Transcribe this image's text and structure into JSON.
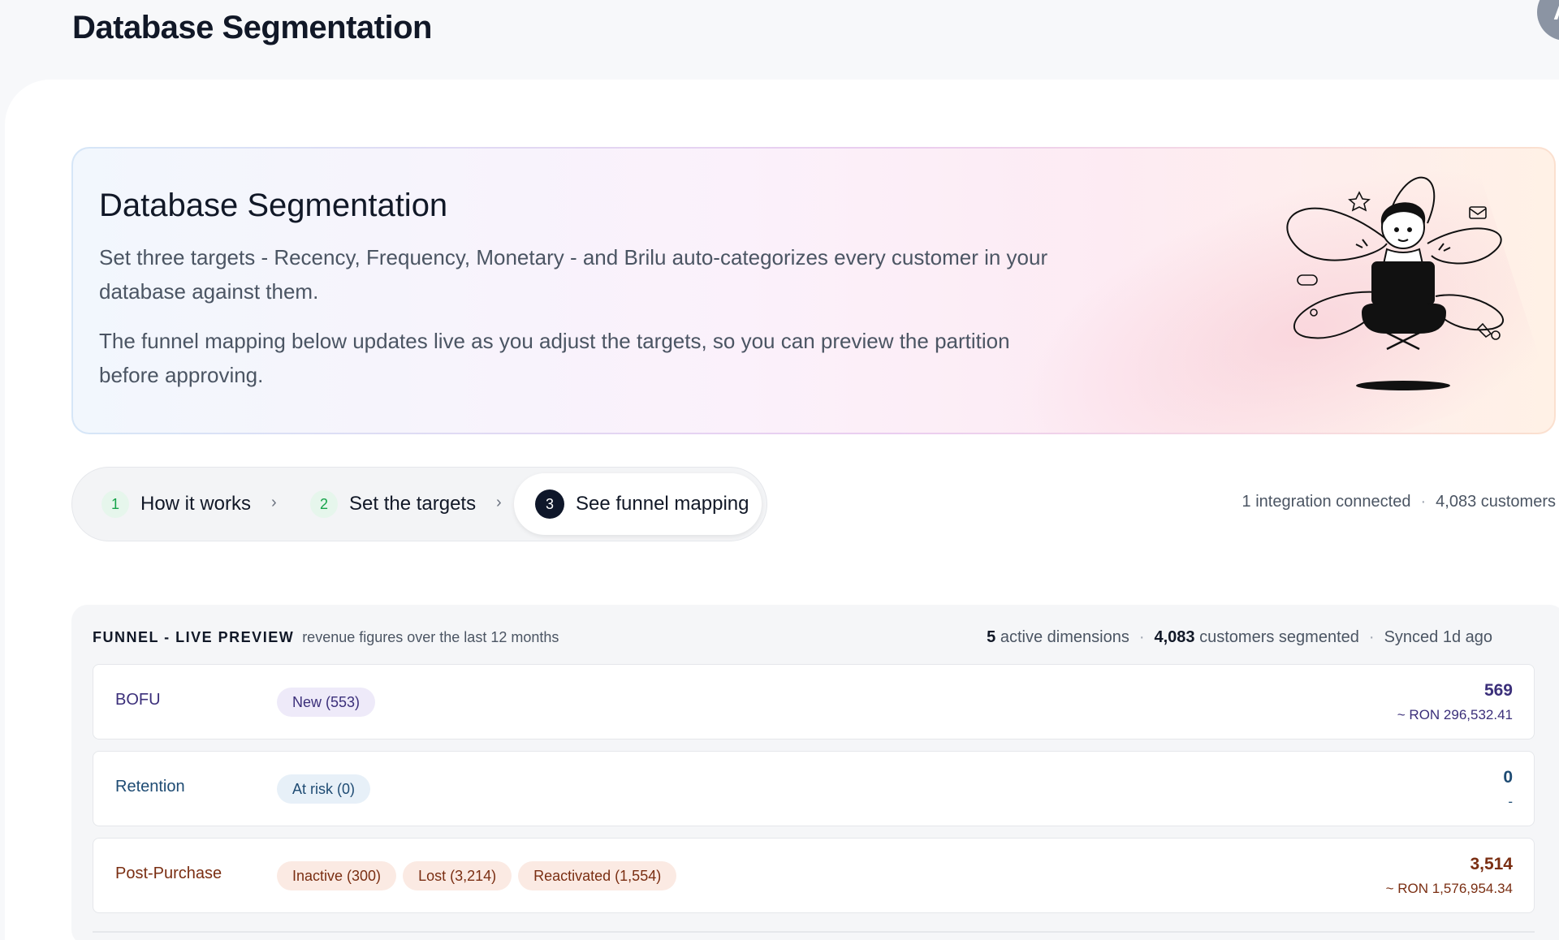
{
  "header": {
    "title": "Database Segmentation",
    "avatar_initial": "A"
  },
  "hero": {
    "title": "Database Segmentation",
    "paragraph1": "Set three targets - Recency, Frequency, Monetary - and Brilu auto-categorizes every customer in your database against them.",
    "paragraph2": "The funnel mapping below updates live as you adjust the targets, so you can preview the partition before approving.",
    "illustration_icon": "person-with-laptop-icon"
  },
  "stepper": {
    "steps": [
      {
        "number": "1",
        "label": "How it works"
      },
      {
        "number": "2",
        "label": "Set the targets"
      },
      {
        "number": "3",
        "label": "See funnel mapping"
      }
    ],
    "separator": "›",
    "active_index": 2
  },
  "integration": {
    "connected": "1 integration connected",
    "separator": "·",
    "customers": "4,083 customers"
  },
  "funnel": {
    "title": "FUNNEL - LIVE PREVIEW",
    "subtitle": "revenue figures over the last 12 months",
    "active_count": "5",
    "active_label": "active dimensions",
    "segmented_count": "4,083",
    "segmented_label": "customers segmented",
    "synced": "Synced 1d ago",
    "separator": "·",
    "rows": [
      {
        "label": "BOFU",
        "chips": [
          "New (553)"
        ],
        "count": "569",
        "revenue": "~ RON 296,532.41"
      },
      {
        "label": "Retention",
        "chips": [
          "At risk (0)"
        ],
        "count": "0",
        "revenue": "-"
      },
      {
        "label": "Post-Purchase",
        "chips": [
          "Inactive (300)",
          "Lost (3,214)",
          "Reactivated (1,554)"
        ],
        "count": "3,514",
        "revenue": "~ RON 1,576,954.34"
      }
    ]
  },
  "colors": {
    "bofu": "#3b2f7a",
    "retention": "#1e4b73",
    "post_purchase": "#7a2e12",
    "step_done": "#16a34a",
    "step_active": "#0f172a"
  }
}
